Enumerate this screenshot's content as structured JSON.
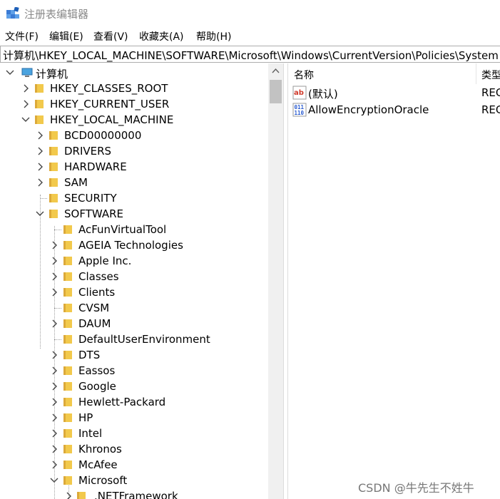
{
  "window": {
    "title": "注册表编辑器"
  },
  "menu": [
    "文件(F)",
    "编辑(E)",
    "查看(V)",
    "收藏夹(A)",
    "帮助(H)"
  ],
  "address": {
    "path": "计算机\\HKEY_LOCAL_MACHINE\\SOFTWARE\\Microsoft\\Windows\\CurrentVersion\\Policies\\System"
  },
  "tree": {
    "root": "计算机",
    "nodes": [
      {
        "label": "HKEY_CLASSES_ROOT",
        "state": "collapsed"
      },
      {
        "label": "HKEY_CURRENT_USER",
        "state": "collapsed"
      },
      {
        "label": "HKEY_LOCAL_MACHINE",
        "state": "expanded"
      },
      {
        "label": "BCD00000000",
        "state": "collapsed"
      },
      {
        "label": "DRIVERS",
        "state": "collapsed"
      },
      {
        "label": "HARDWARE",
        "state": "collapsed"
      },
      {
        "label": "SAM",
        "state": "collapsed"
      },
      {
        "label": "SECURITY",
        "state": "leaf"
      },
      {
        "label": "SOFTWARE",
        "state": "expanded"
      },
      {
        "label": "AcFunVirtualTool",
        "state": "leaf"
      },
      {
        "label": "AGEIA Technologies",
        "state": "collapsed"
      },
      {
        "label": "Apple Inc.",
        "state": "collapsed"
      },
      {
        "label": "Classes",
        "state": "collapsed"
      },
      {
        "label": "Clients",
        "state": "collapsed"
      },
      {
        "label": "CVSM",
        "state": "leaf"
      },
      {
        "label": "DAUM",
        "state": "collapsed"
      },
      {
        "label": "DefaultUserEnvironment",
        "state": "leaf"
      },
      {
        "label": "DTS",
        "state": "collapsed"
      },
      {
        "label": "Eassos",
        "state": "collapsed"
      },
      {
        "label": "Google",
        "state": "collapsed"
      },
      {
        "label": "Hewlett-Packard",
        "state": "collapsed"
      },
      {
        "label": "HP",
        "state": "collapsed"
      },
      {
        "label": "Intel",
        "state": "collapsed"
      },
      {
        "label": "Khronos",
        "state": "collapsed"
      },
      {
        "label": "McAfee",
        "state": "collapsed"
      },
      {
        "label": "Microsoft",
        "state": "expanded"
      },
      {
        "label": ".NETFramework",
        "state": "collapsed"
      }
    ]
  },
  "list": {
    "columns": {
      "name": "名称",
      "type": "类型"
    },
    "rows": [
      {
        "name": "(默认)",
        "type": "REG",
        "icon": "string-value-icon"
      },
      {
        "name": "AllowEncryptionOracle",
        "type": "REG",
        "icon": "binary-value-icon"
      }
    ]
  },
  "watermark": "CSDN @牛先生不姓牛",
  "colors": {
    "folder": "#f2c94c",
    "folder_dark": "#dca93a",
    "scroll_thumb": "#c2c2c2",
    "string_icon": "#d03a2a",
    "binary_icon": "#2a5bd0"
  }
}
